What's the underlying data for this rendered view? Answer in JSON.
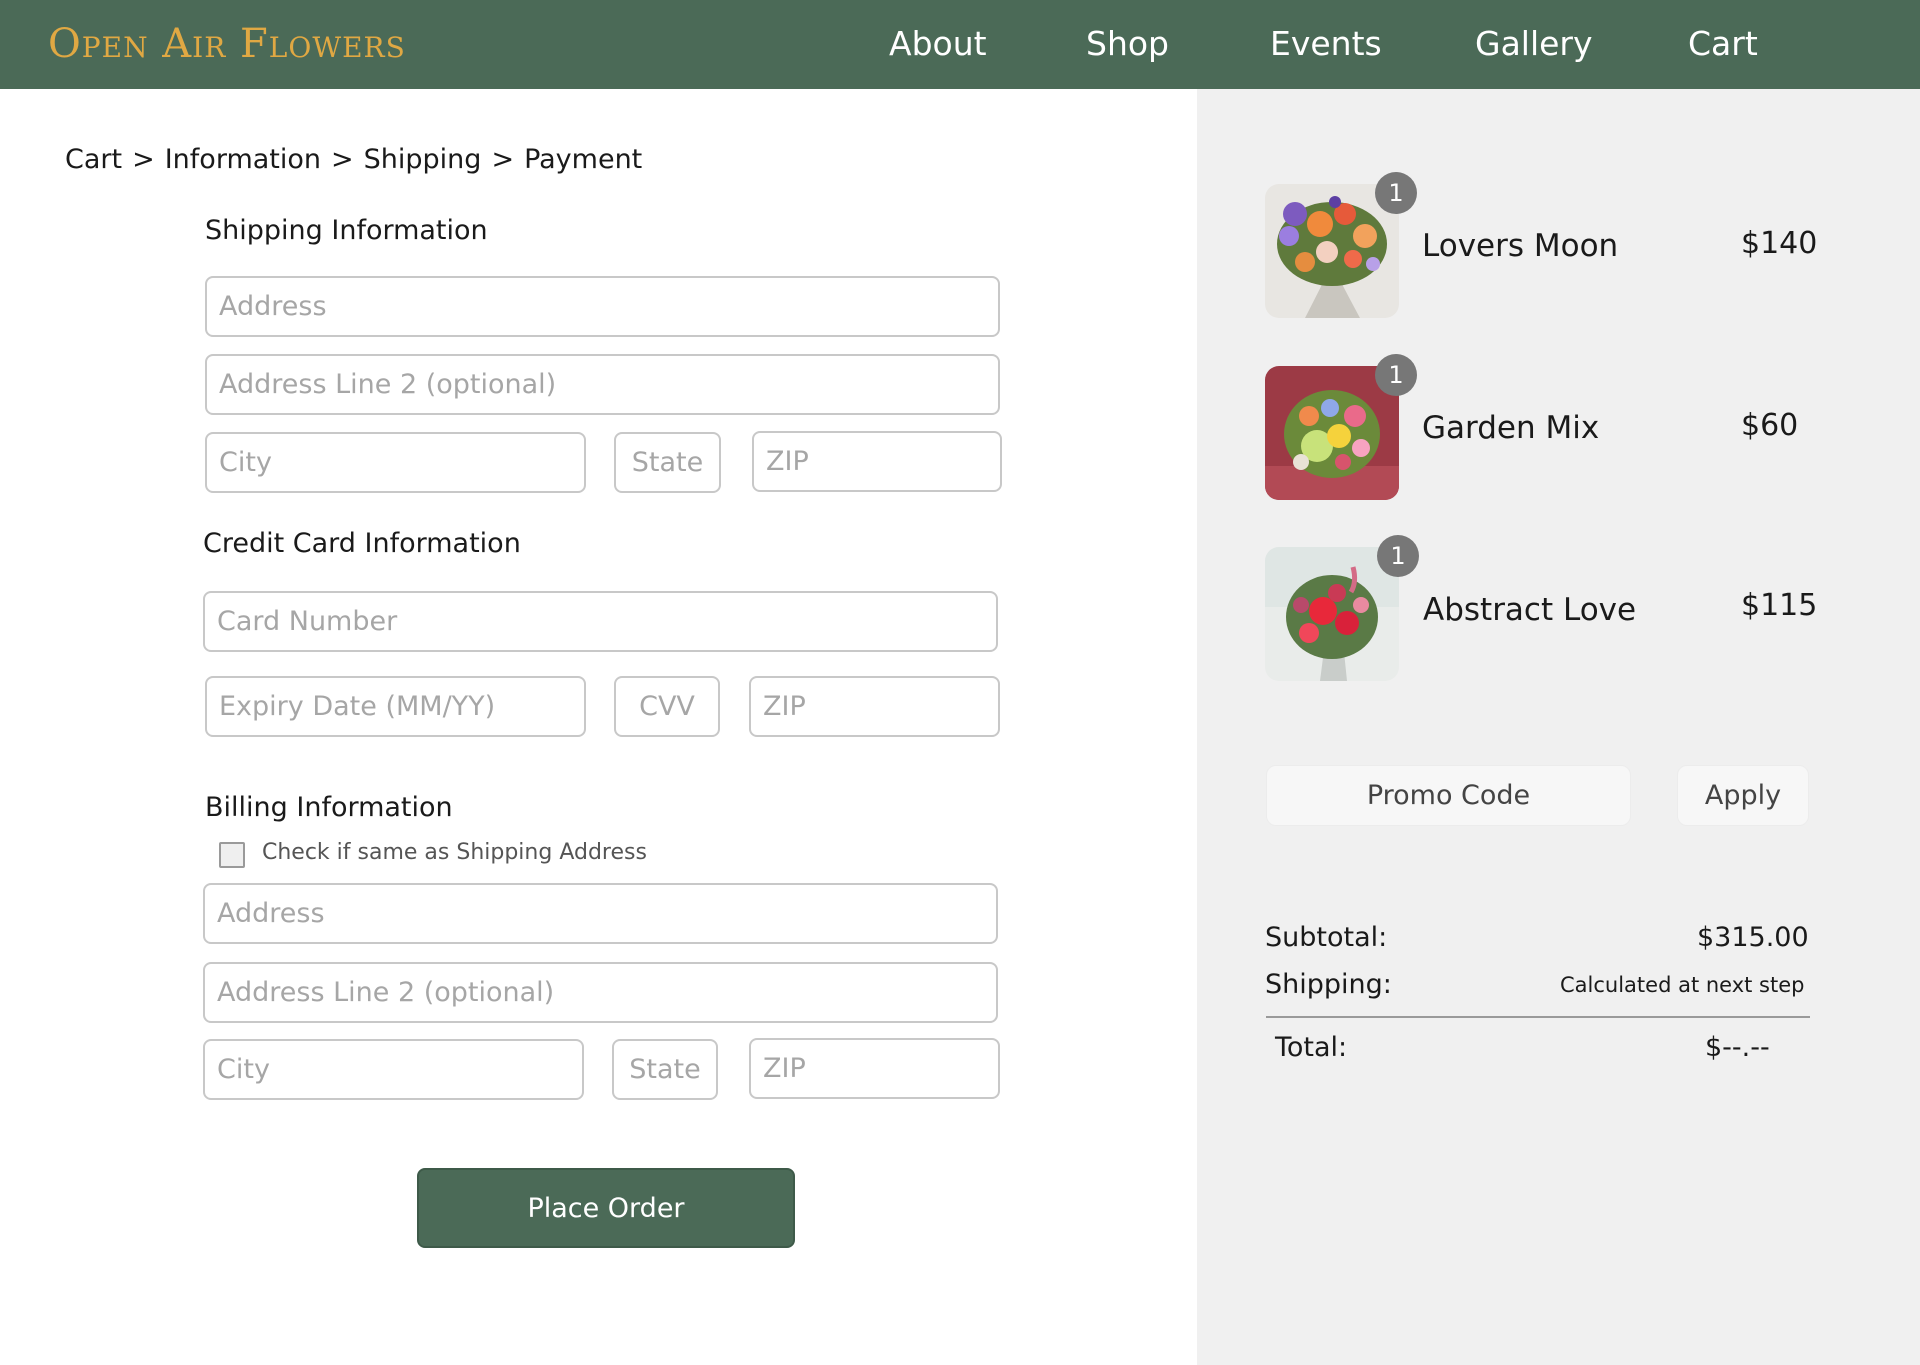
{
  "header": {
    "logo": "Open Air Flowers",
    "nav": [
      "About",
      "Shop",
      "Events",
      "Gallery",
      "Cart"
    ]
  },
  "breadcrumb": [
    "Cart",
    "Information",
    "Shipping",
    "Payment"
  ],
  "breadcrumb_separator": ">",
  "shipping": {
    "title": "Shipping Information",
    "address_placeholder": "Address",
    "address2_placeholder": "Address Line 2 (optional)",
    "city_placeholder": "City",
    "state_placeholder": "State",
    "zip_placeholder": "ZIP"
  },
  "card": {
    "title": "Credit Card Information",
    "number_placeholder": "Card Number",
    "expiry_placeholder": "Expiry Date (MM/YY)",
    "cvv_placeholder": "CVV",
    "zip_placeholder": "ZIP"
  },
  "billing": {
    "title": "Billing Information",
    "same_as_shipping_label": "Check if same as Shipping Address",
    "same_as_shipping_checked": false,
    "address_placeholder": "Address",
    "address2_placeholder": "Address Line 2 (optional)",
    "city_placeholder": "City",
    "state_placeholder": "State",
    "zip_placeholder": "ZIP"
  },
  "place_order_label": "Place Order",
  "cart": {
    "items": [
      {
        "name": "Lovers Moon",
        "price": "$140",
        "qty": "1"
      },
      {
        "name": "Garden Mix",
        "price": "$60",
        "qty": "1"
      },
      {
        "name": "Abstract Love",
        "price": "$115",
        "qty": "1"
      }
    ],
    "promo_placeholder": "Promo Code",
    "apply_label": "Apply",
    "subtotal_label": "Subtotal:",
    "subtotal_value": "$315.00",
    "shipping_label": "Shipping:",
    "shipping_value": "Calculated at next step",
    "total_label": "Total:",
    "total_value": "$--.--"
  },
  "colors": {
    "header_bg": "#4b6a57",
    "logo": "#e0a843",
    "summary_bg": "#f0f0f0",
    "button_bg": "#4b6a57"
  }
}
